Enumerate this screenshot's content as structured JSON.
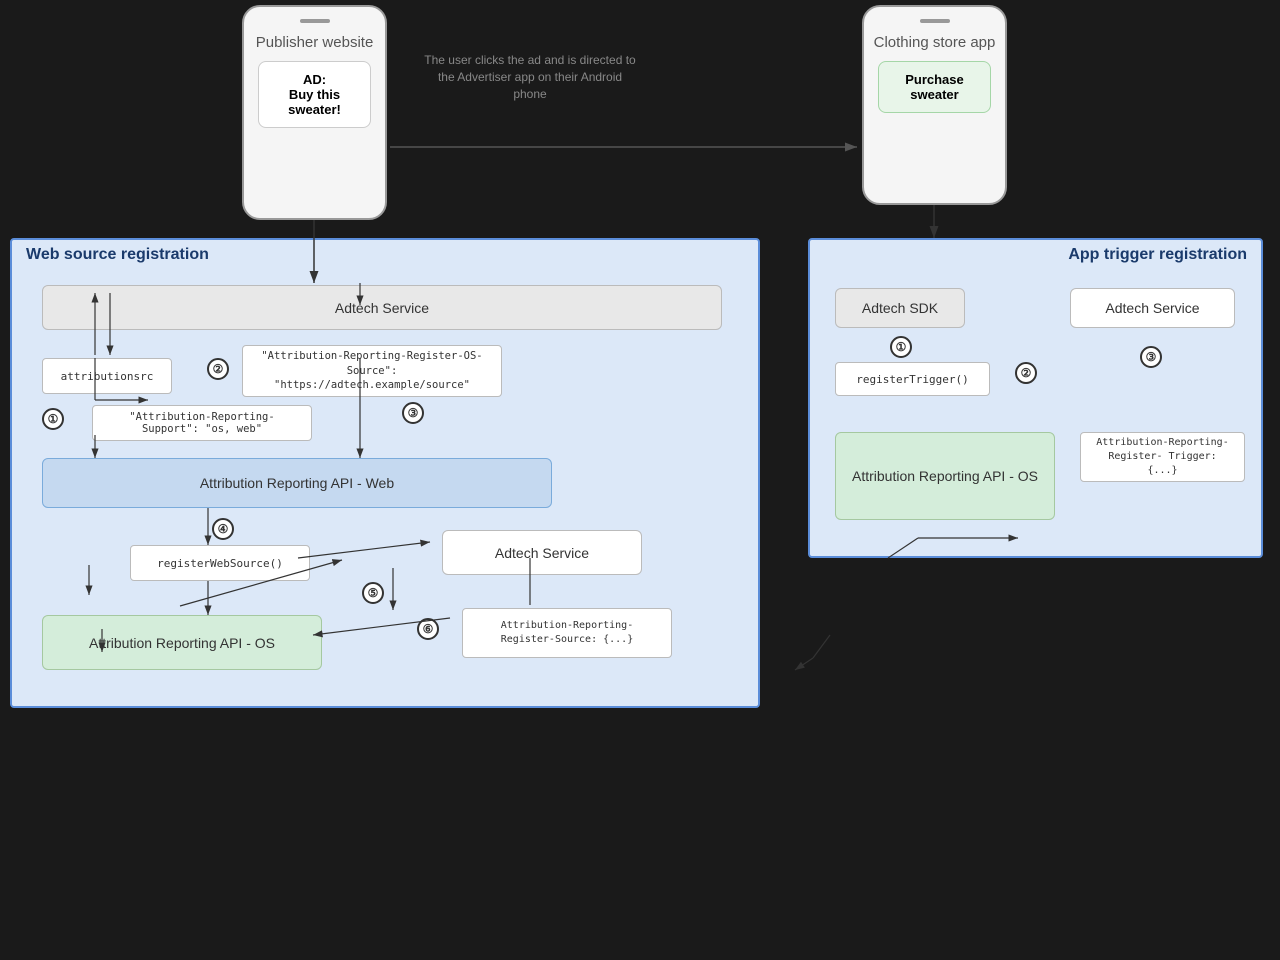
{
  "phones": {
    "publisher": {
      "title": "Publisher website",
      "ad_label": "AD:",
      "ad_text": "Buy this sweater!"
    },
    "clothing": {
      "title": "Clothing store app",
      "button": "Purchase sweater"
    }
  },
  "arrow_text": "The user clicks the ad and is directed to the Advertiser app on their Android phone",
  "web_source": {
    "title": "Web source registration",
    "adtech_service_top": "Adtech Service",
    "attributionsrc": "attributionsrc",
    "header_response": "\"Attribution-Reporting-Register-OS-Source\":\n\"https://adtech.example/source\"",
    "support_header": "\"Attribution-Reporting-Support\": \"os, web\"",
    "api_web": "Attribution Reporting API - Web",
    "num2": "②",
    "num3": "③",
    "num1": "①",
    "num4": "④",
    "num5": "⑤",
    "num6": "⑥",
    "registerWebSource": "registerWebSource()",
    "adtech_service_bottom": "Adtech Service",
    "api_os": "Attribution Reporting API - OS",
    "register_source_code": "Attribution-Reporting-\nRegister-Source: {...}"
  },
  "app_trigger": {
    "title": "App trigger registration",
    "adtech_sdk": "Adtech SDK",
    "num1": "①",
    "num2": "②",
    "num3": "③",
    "registerTrigger": "registerTrigger()",
    "adtech_service": "Adtech Service",
    "api_os": "Attribution Reporting API - OS",
    "register_trigger_code": "Attribution-Reporting-Register-\nTrigger: {...}"
  }
}
